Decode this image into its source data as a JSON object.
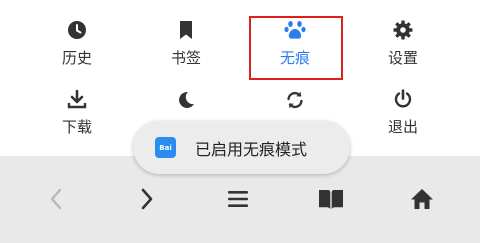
{
  "menu": {
    "items": [
      {
        "label": "历史",
        "icon": "clock-icon"
      },
      {
        "label": "书签",
        "icon": "bookmark-icon"
      },
      {
        "label": "无痕",
        "icon": "paw-icon"
      },
      {
        "label": "设置",
        "icon": "gear-icon"
      },
      {
        "label": "下载",
        "icon": "download-icon"
      },
      {
        "label": "",
        "icon": "moon-icon"
      },
      {
        "label": "",
        "icon": "refresh-icon"
      },
      {
        "label": "退出",
        "icon": "power-icon"
      }
    ],
    "active_item": "无痕"
  },
  "toast": {
    "text": "已启用无痕模式",
    "app_icon_text": "Bai"
  },
  "bottom_nav": {
    "items": [
      "back",
      "forward",
      "menu",
      "bookmarks",
      "home"
    ]
  },
  "colors": {
    "accent": "#2b7de9",
    "highlight_border": "#e01e1e",
    "icon": "#333333",
    "disabled_icon": "#b8b8b8"
  }
}
